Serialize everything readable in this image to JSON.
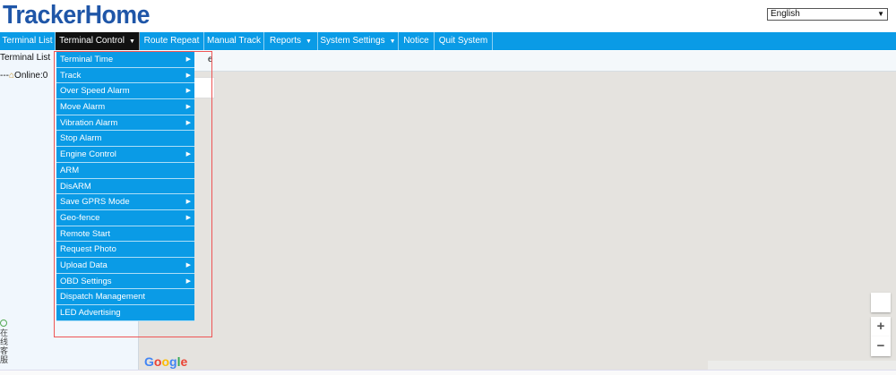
{
  "app": {
    "logo": "TrackerHome"
  },
  "language": {
    "selected": "English"
  },
  "nav": {
    "items": [
      {
        "label": "Terminal List"
      },
      {
        "label": "Terminal Control"
      },
      {
        "label": "Route Repeat"
      },
      {
        "label": "Manual Track"
      },
      {
        "label": "Reports"
      },
      {
        "label": "System Settings"
      },
      {
        "label": "Notice"
      },
      {
        "label": "Quit System"
      }
    ]
  },
  "sidebar": {
    "title": "Terminal List",
    "tree_online": "Online:0"
  },
  "tab_fragment": "e",
  "menu": {
    "items": [
      {
        "label": "Terminal Time",
        "has_submenu": true
      },
      {
        "label": "Track",
        "has_submenu": true
      },
      {
        "label": "Over Speed Alarm",
        "has_submenu": true
      },
      {
        "label": "Move Alarm",
        "has_submenu": true
      },
      {
        "label": "Vibration Alarm",
        "has_submenu": true
      },
      {
        "label": "Stop Alarm",
        "has_submenu": false
      },
      {
        "label": "Engine Control",
        "has_submenu": true
      },
      {
        "label": "ARM",
        "has_submenu": false
      },
      {
        "label": "DisARM",
        "has_submenu": false
      },
      {
        "label": "Save GPRS Mode",
        "has_submenu": true
      },
      {
        "label": "Geo-fence",
        "has_submenu": true
      },
      {
        "label": "Remote Start",
        "has_submenu": false
      },
      {
        "label": "Request Photo",
        "has_submenu": false
      },
      {
        "label": "Upload Data",
        "has_submenu": true
      },
      {
        "label": "OBD Settings",
        "has_submenu": true
      },
      {
        "label": "Dispatch Management",
        "has_submenu": false
      },
      {
        "label": "LED Advertising",
        "has_submenu": false
      }
    ]
  },
  "map": {
    "google_letters": [
      "G",
      "o",
      "o",
      "g",
      "l",
      "e"
    ],
    "zoom_in": "+",
    "zoom_out": "−"
  },
  "side_widget": {
    "text": "在线客服"
  },
  "colors": {
    "nav_bg": "#0a9be6",
    "logo": "#1f56a8",
    "active_nav": "#111111"
  }
}
